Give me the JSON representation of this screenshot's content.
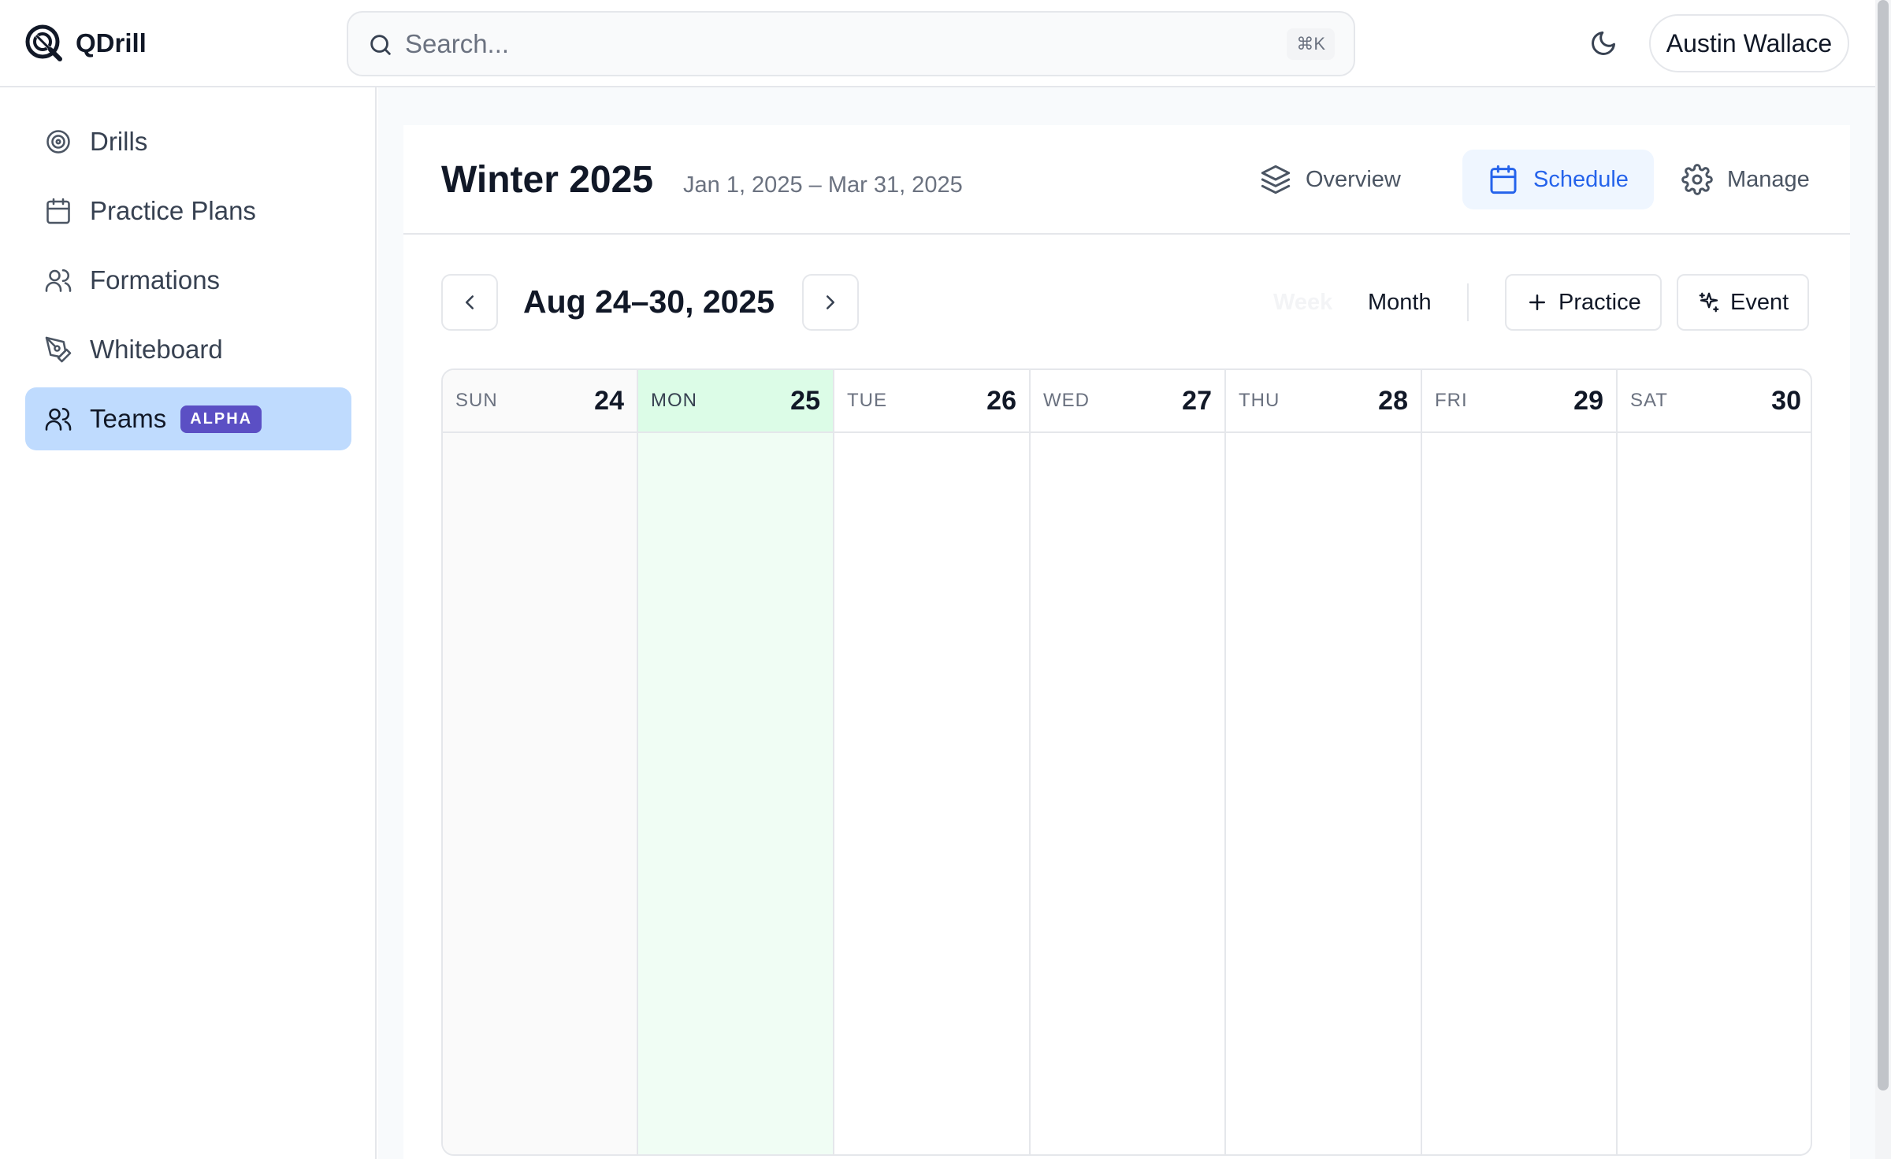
{
  "app": {
    "name": "QDrill"
  },
  "search": {
    "placeholder": "Search...",
    "shortcut": "⌘K"
  },
  "user": {
    "name": "Austin Wallace"
  },
  "sidebar": {
    "items": [
      {
        "label": "Drills",
        "icon": "target-icon"
      },
      {
        "label": "Practice Plans",
        "icon": "calendar-icon"
      },
      {
        "label": "Formations",
        "icon": "users-icon"
      },
      {
        "label": "Whiteboard",
        "icon": "pen-tool-icon"
      },
      {
        "label": "Teams",
        "icon": "users-icon",
        "badge": "ALPHA",
        "active": true
      }
    ]
  },
  "season": {
    "title": "Winter 2025",
    "dates": "Jan 1, 2025 – Mar 31, 2025"
  },
  "tabs": [
    {
      "label": "Overview",
      "icon": "layers-icon"
    },
    {
      "label": "Schedule",
      "icon": "calendar-icon",
      "active": true
    },
    {
      "label": "Manage",
      "icon": "gear-icon"
    }
  ],
  "schedule": {
    "range": "Aug 24–30, 2025",
    "views": {
      "week": "Week",
      "month": "Month"
    },
    "add_practice": "Practice",
    "add_event": "Event"
  },
  "calendar": {
    "days": [
      {
        "name": "SUN",
        "num": "24"
      },
      {
        "name": "MON",
        "num": "25",
        "today": true
      },
      {
        "name": "TUE",
        "num": "26"
      },
      {
        "name": "WED",
        "num": "27"
      },
      {
        "name": "THU",
        "num": "28"
      },
      {
        "name": "FRI",
        "num": "29"
      },
      {
        "name": "SAT",
        "num": "30"
      }
    ]
  },
  "colors": {
    "accent": "#2563eb",
    "active_nav": "#bfdbfe",
    "badge": "#5b4fc4",
    "today": "#dcfce7"
  }
}
